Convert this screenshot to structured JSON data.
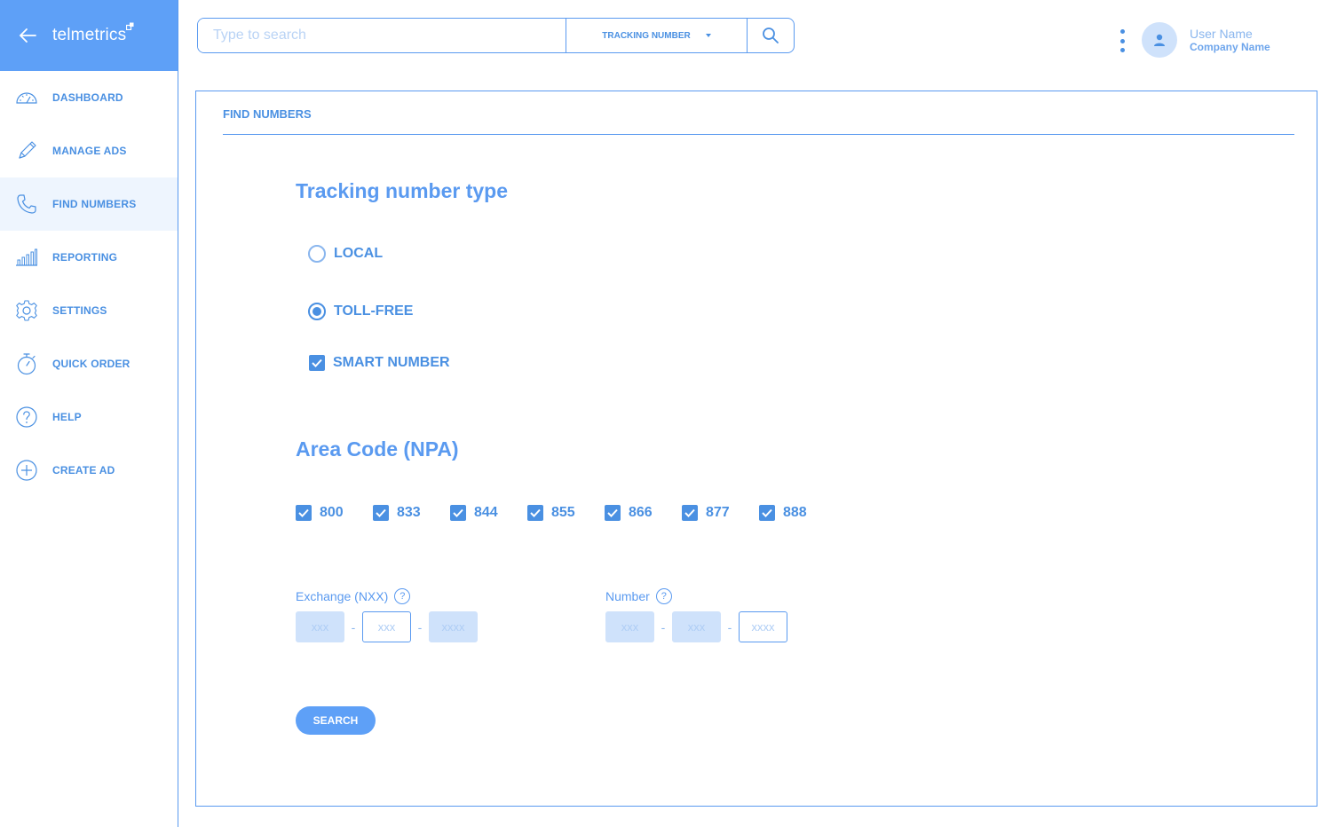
{
  "brand": {
    "logo_text": "telmetrics",
    "back_icon": "arrow-left-icon"
  },
  "sidebar": {
    "items": [
      {
        "label": "DASHBOARD",
        "icon": "gauge-icon",
        "active": false
      },
      {
        "label": "MANAGE ADS",
        "icon": "pencil-icon",
        "active": false
      },
      {
        "label": "FIND NUMBERS",
        "icon": "phone-icon",
        "active": true
      },
      {
        "label": "REPORTING",
        "icon": "bar-chart-icon",
        "active": false
      },
      {
        "label": "SETTINGS",
        "icon": "gear-icon",
        "active": false
      },
      {
        "label": "QUICK ORDER",
        "icon": "stopwatch-icon",
        "active": false
      },
      {
        "label": "HELP",
        "icon": "question-circle-icon",
        "active": false
      },
      {
        "label": "CREATE AD",
        "icon": "plus-circle-icon",
        "active": false
      }
    ]
  },
  "search": {
    "placeholder": "Type to search",
    "type_selected": "TRACKING NUMBER",
    "button_icon": "search-icon"
  },
  "user": {
    "name": "User Name",
    "company": "Company Name"
  },
  "panel": {
    "title": "FIND NUMBERS"
  },
  "tracking": {
    "title": "Tracking number type",
    "options": {
      "local": "LOCAL",
      "toll_free": "TOLL-FREE",
      "smart": "SMART NUMBER"
    },
    "selected": "TOLL-FREE",
    "smart_checked": true
  },
  "area_code": {
    "title": "Area Code (NPA)",
    "codes": [
      "800",
      "833",
      "844",
      "855",
      "866",
      "877",
      "888"
    ],
    "all_checked": true
  },
  "exchange": {
    "label": "Exchange (NXX)",
    "help": "?",
    "placeholders": [
      "xxx",
      "xxx",
      "xxxx"
    ],
    "dash": "-"
  },
  "number": {
    "label": "Number",
    "help": "?",
    "placeholders": [
      "xxx",
      "xxx",
      "xxxx"
    ],
    "dash": "-"
  },
  "actions": {
    "search_label": "SEARCH"
  },
  "colors": {
    "primary": "#5ea0f7",
    "text": "#4a90e2",
    "light_fill": "#cfe2fb"
  }
}
